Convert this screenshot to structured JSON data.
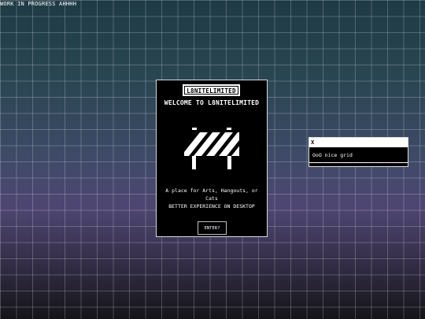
{
  "banner": {
    "text": "WORK IN PROGRESS AHHHH"
  },
  "main_window": {
    "brand": "L8NITELIMITED",
    "welcome": "WELCOME TO L8NITELIMITED",
    "icon": "road-barrier-icon",
    "description": "A place for Arts, Hangouts, or Cats",
    "note": "BETTER EXPERIENCE ON DESKTOP",
    "enter_label": "ENTER?"
  },
  "popup": {
    "close_label": "X",
    "message": "OoO nice grid"
  },
  "colors": {
    "window_bg": "#000000",
    "window_border": "#d9d9d9",
    "text": "#ffffff",
    "grid_line": "rgba(255,255,255,0.22)"
  }
}
